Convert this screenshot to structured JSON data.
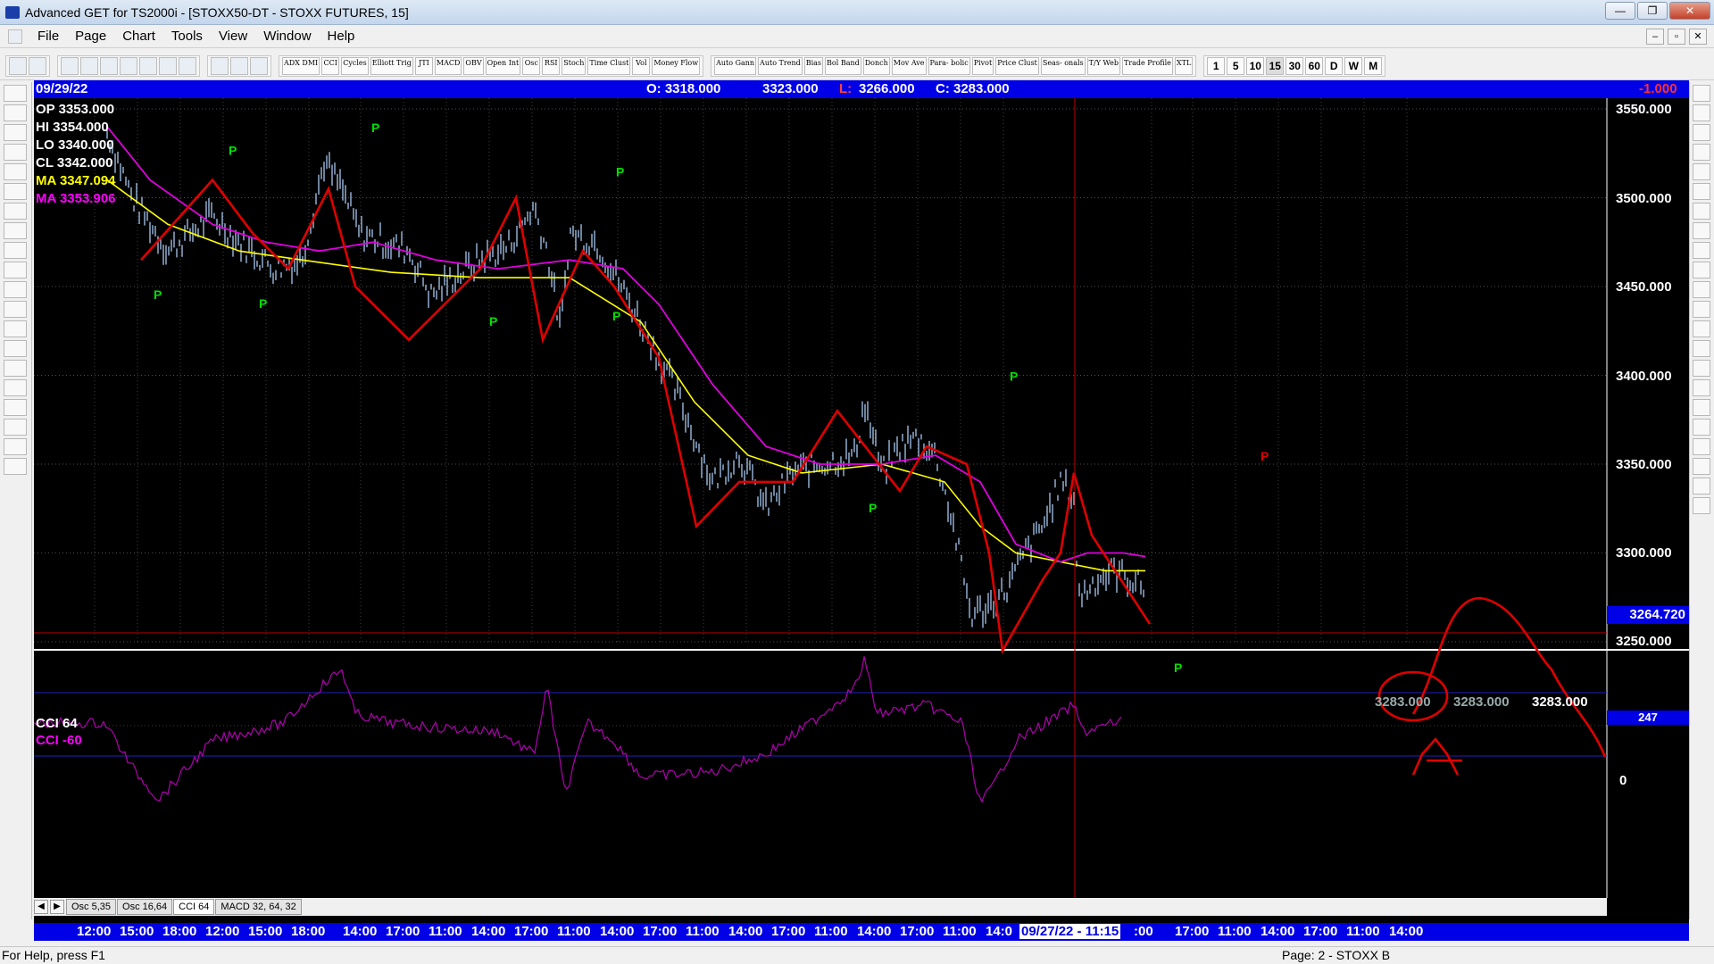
{
  "window": {
    "title": "Advanced GET for TS2000i - [STOXX50-DT - STOXX FUTURES, 15]",
    "minimize": "—",
    "maximize": "❐",
    "close": "✕"
  },
  "menu": [
    "File",
    "Page",
    "Chart",
    "Tools",
    "View",
    "Window",
    "Help"
  ],
  "mdi_controls": [
    "–",
    "▫",
    "✕"
  ],
  "toolbar": {
    "studies": [
      "ADX DMI",
      "CCI",
      "Cycles",
      "Elliott Trig",
      "JTI",
      "MACD",
      "OBV",
      "Open Int",
      "Osc",
      "RSI",
      "Stoch",
      "Time Clust",
      "Vol",
      "Money Flow"
    ],
    "studies2": [
      "Auto Gann",
      "Auto Trend",
      "Bias",
      "Bol Band",
      "Donch",
      "Mov Ave",
      "Para- bolic",
      "Pivot",
      "Price Clust",
      "Seas- onals",
      "T/Y Web",
      "Trade Profile",
      "XTL"
    ],
    "timeframes": [
      "1",
      "5",
      "10",
      "15",
      "30",
      "60",
      "D",
      "W",
      "M"
    ],
    "active_timeframe": "15"
  },
  "infobar": {
    "date": "09/29/22",
    "open": "O: 3318.000",
    "high": "3323.000",
    "low_label": "L:",
    "low": "3266.000",
    "close": "C: 3283.000",
    "change": "-1.000"
  },
  "legend": {
    "op": "OP  3353.000",
    "hi": "HI    3354.000",
    "lo": "LO   3340.000",
    "cl": "CL   3342.000",
    "ma1": "MA  3347.094",
    "ma2": "MA  3353.906"
  },
  "price_axis": [
    "3550.000",
    "3500.000",
    "3450.000",
    "3400.000",
    "3350.000",
    "3300.000",
    "3250.000"
  ],
  "current_price": "3264.720",
  "projection_labels": [
    "3283.000",
    "3283.000",
    "3283.000"
  ],
  "pivot_label": "P",
  "cci": {
    "title": "CCI 64",
    "value_label": "CCI  -60",
    "axis_top": "247",
    "axis_zero": "0"
  },
  "tabs": {
    "nav_prev": "◀",
    "nav_next": "▶",
    "items": [
      "Osc 5,35",
      "Osc 16,64",
      "CCI 64",
      "MACD 32, 64, 32"
    ],
    "active": "CCI 64"
  },
  "time_axis": {
    "labels": [
      "12:00",
      "15:00",
      "18:00",
      "12:00",
      "15:00",
      "18:00",
      "14:00",
      "17:00",
      "11:00",
      "14:00",
      "17:00",
      "11:00",
      "14:00",
      "17:00",
      "11:00",
      "14:00",
      "17:00",
      "11:00",
      "14:00",
      "17:00",
      "11:00",
      "14:0"
    ],
    "cursor_label": "09/27/22 - 11:15",
    "labels_after": [
      ":00",
      "17:00",
      "11:00",
      "14:00",
      "17:00",
      "11:00",
      "14:00"
    ]
  },
  "status": {
    "help": "For Help, press F1",
    "page": "Page: 2 - STOXX B"
  },
  "colors": {
    "background": "#000000",
    "bars": "#a8c8f0",
    "ma_yellow": "#ffff00",
    "ma_magenta": "#e000e0",
    "zigzag": "#e00000",
    "pivot": "#00e000",
    "cci": "#b000b0",
    "infobar": "#0000e6"
  }
}
